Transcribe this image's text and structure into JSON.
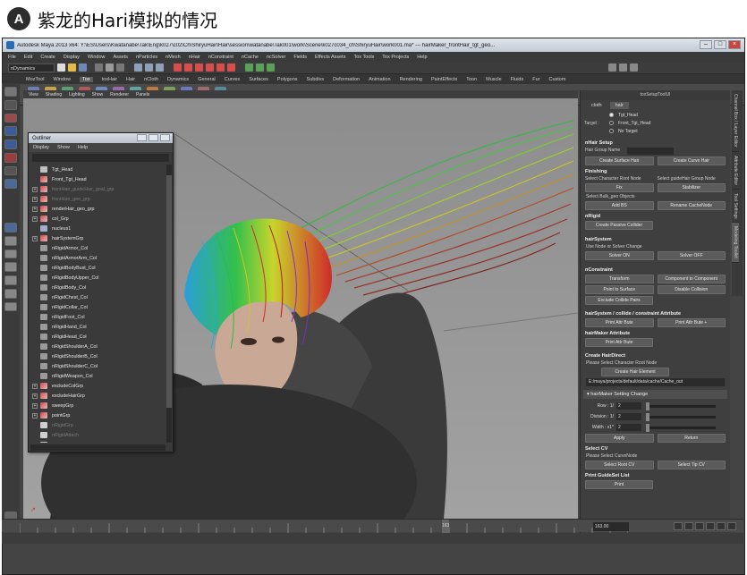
{
  "caption": {
    "badge": "A",
    "text": "紫龙的Hari模拟的情况"
  },
  "window": {
    "title": "Autodesk Maya 2013 x64: Y:\\ES\\Users\\Kwatanabe\\Tak\\Eng\\k027\\c02\\Ch\\ShiryuHair\\Hair\\session\\watanabe\\Tak001\\work\\Scene\\k027c034_ch\\ShiryuHair\\work001.ma* --- hairMaker_frontHair_tgt_geo..."
  },
  "menubar": [
    "File",
    "Edit",
    "Create",
    "Display",
    "Window",
    "Assets",
    "nParticles",
    "nMesh",
    "nHair",
    "nConstraint",
    "nCache",
    "ncSolver",
    "Fields",
    "Effects Assets",
    "Tox Tools",
    "Tox Projects",
    "Help"
  ],
  "mode_selector": "nDynamics",
  "shelf_tabs": [
    "MozTool",
    "Window",
    "Tox",
    "toxHair",
    "Hair",
    "nCloth",
    "Dynamics",
    "General",
    "Curves",
    "Surfaces",
    "Polygons",
    "Subdivs",
    "Deformation",
    "Animation",
    "Rendering",
    "PaintEffects",
    "Toon",
    "Muscle",
    "Fluids",
    "Fur",
    "Custom"
  ],
  "shelf_active": "Tox",
  "shelf_items": [
    "RtVis",
    "attList",
    "reCVs",
    "locSet",
    "Wrap",
    "perse",
    "Sim",
    "init",
    "SimTo",
    "SimTo",
    "mRes",
    "Print"
  ],
  "viewport_menu": [
    "View",
    "Shading",
    "Lighting",
    "Show",
    "Renderer",
    "Panels"
  ],
  "outliner": {
    "title": "Outliner",
    "menu": [
      "Display",
      "Show",
      "Help"
    ],
    "items": [
      {
        "label": "Tgt_Head",
        "icon": "cam",
        "exp": false,
        "dim": false
      },
      {
        "label": "Front_Tgt_Head",
        "icon": "mesh",
        "exp": false,
        "dim": false
      },
      {
        "label": "frontHair_guideHair_goal_grp",
        "icon": "mesh",
        "exp": true,
        "dim": true
      },
      {
        "label": "frontHair_geo_grp",
        "icon": "mesh",
        "exp": true,
        "dim": true
      },
      {
        "label": "renderHair_geo_grp",
        "icon": "mesh",
        "exp": true,
        "dim": false
      },
      {
        "label": "col_Grp",
        "icon": "mesh",
        "exp": true,
        "dim": false
      },
      {
        "label": "nucleus1",
        "icon": "nucl",
        "exp": false,
        "dim": false
      },
      {
        "label": "hairSystemGrp",
        "icon": "mesh",
        "exp": true,
        "dim": false
      },
      {
        "label": "nRigidArmor_Col",
        "icon": "cap",
        "exp": false,
        "dim": false
      },
      {
        "label": "nRigidArmorArm_Col",
        "icon": "cap",
        "exp": false,
        "dim": false
      },
      {
        "label": "nRigidBodyBust_Col",
        "icon": "cap",
        "exp": false,
        "dim": false
      },
      {
        "label": "nRigidBodyUpper_Col",
        "icon": "cap",
        "exp": false,
        "dim": false
      },
      {
        "label": "nRigidBody_Col",
        "icon": "cap",
        "exp": false,
        "dim": false
      },
      {
        "label": "nRigidChest_Col",
        "icon": "cap",
        "exp": false,
        "dim": false
      },
      {
        "label": "nRigidCollar_Col",
        "icon": "cap",
        "exp": false,
        "dim": false
      },
      {
        "label": "nRigidFoot_Col",
        "icon": "cap",
        "exp": false,
        "dim": false
      },
      {
        "label": "nRigidHand_Col",
        "icon": "cap",
        "exp": false,
        "dim": false
      },
      {
        "label": "nRigidHead_Col",
        "icon": "cap",
        "exp": false,
        "dim": false
      },
      {
        "label": "nRigidShoulderA_Col",
        "icon": "cap",
        "exp": false,
        "dim": false
      },
      {
        "label": "nRigidShoulderB_Col",
        "icon": "cap",
        "exp": false,
        "dim": false
      },
      {
        "label": "nRigidShoulderC_Col",
        "icon": "cap",
        "exp": false,
        "dim": false
      },
      {
        "label": "nRigidWeapon_Col",
        "icon": "cap",
        "exp": false,
        "dim": false
      },
      {
        "label": "excludeColGrp",
        "icon": "mesh",
        "exp": true,
        "dim": false
      },
      {
        "label": "excludeHairGrp",
        "icon": "mesh",
        "exp": true,
        "dim": false
      },
      {
        "label": "sweepGrp",
        "icon": "mesh",
        "exp": true,
        "dim": false
      },
      {
        "label": "pointGrp",
        "icon": "mesh",
        "exp": true,
        "dim": false
      },
      {
        "label": "nRigidGrp",
        "icon": "grp",
        "exp": false,
        "dim": true
      },
      {
        "label": "nRigidAttach",
        "icon": "grp",
        "exp": false,
        "dim": true
      },
      {
        "label": "defaultLightSet",
        "icon": "grp",
        "exp": false,
        "dim": true
      }
    ]
  },
  "panel": {
    "header": "toxSetupToolUI",
    "tabs": [
      "cloth",
      "hair"
    ],
    "active_tab": "hair",
    "target_label": "Target :",
    "targets": [
      {
        "label": "Tgt_Head",
        "on": true
      },
      {
        "label": "Front_Tgt_Head",
        "on": false
      },
      {
        "label": "No Target",
        "on": false
      }
    ],
    "sec_setup": "nHair Setup",
    "hair_group_label": "Hair Group Name",
    "btn_create_surface": "Create Surface Hair",
    "btn_create_curve": "Create Curve Hair",
    "sec_finishing": "Finishing",
    "select_root": "Select Character Root Node",
    "select_guide_group": "Select guideHair Group Node",
    "btn_fix": "Fix",
    "btn_stabilizer": "Stabilizer",
    "select_bulk": "Select Bulk_geo Objects",
    "btn_add_bs": "Add BS",
    "btn_rename_cache": "Rename CacheNode",
    "sec_nrigid": "nRigid",
    "btn_create_passive": "Create Passive Collider",
    "sec_hairsystem": "hairSystem",
    "use_nodes": "Use Node or Solver Change",
    "btn_solver_on": "Solver ON",
    "btn_solver_off": "Solver OFF",
    "sec_nconstraint": "nConstraint",
    "btn_transform": "Transform",
    "btn_component": "Component to Component",
    "btn_point_surface": "Point to Surface",
    "btn_disable_collision": "Disable Collision",
    "btn_exclude_pairs": "Exclude Collide Pairs",
    "sec_attr": "hairSystem / collide / constraint Attribute",
    "btn_print_attr": "Print Attr Bute",
    "btn_print_attr_plus": "Print Attr Bute +",
    "sec_hairmaker_attr": "hairMaker Attribute",
    "btn_print_attr2": "Print Attr Bute",
    "sec_hairdirect": "Create HairDirect",
    "select_char_root": "Please Select Character Root Node",
    "btn_create_hair_element": "Create Hair Element",
    "cache_path": "E:/maya/projects/default/data/cache/Cache_out",
    "collapse_title": "hairMaker Setting Change",
    "sliders": [
      {
        "label": "Row : 1/",
        "value": "2",
        "frac": 0.0
      },
      {
        "label": "Division : 1/",
        "value": "2",
        "frac": 0.0
      },
      {
        "label": "Width : x1*",
        "value": "2",
        "frac": 0.0
      }
    ],
    "btn_apply": "Apply",
    "btn_return": "Return",
    "sec_select_cv": "Select CV",
    "select_curve_node": "Please Select CurveNode",
    "btn_select_root_cv": "Select Root CV",
    "btn_select_tip_cv": "Select Tip CV",
    "sec_print_guide": "Print GuideSet List",
    "btn_print": "Print"
  },
  "side_tabs": [
    "Channel Box / Layer Editor",
    "Attribute Editor",
    "Tool Settings",
    "Modeling Toolkit"
  ],
  "timeline": {
    "frame": "163.00",
    "marker": "163"
  }
}
